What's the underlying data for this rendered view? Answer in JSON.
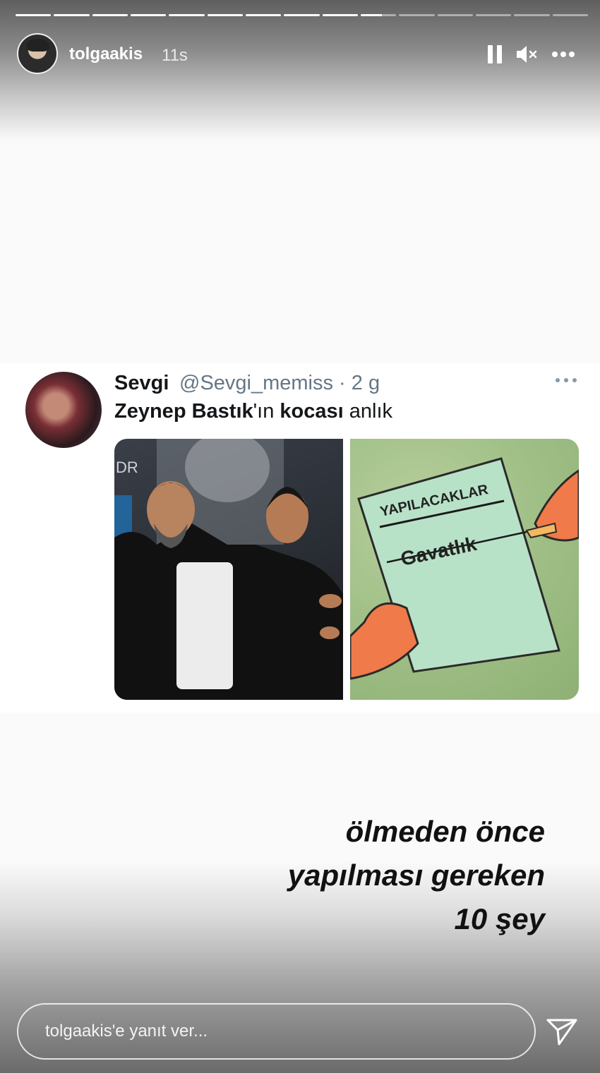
{
  "story": {
    "progress_segments": 15,
    "progress_completed_segments": 9,
    "progress_current_fraction": 0.6
  },
  "header": {
    "username": "tolgaakis",
    "time": "11s",
    "icons": [
      "pause-icon",
      "mute-icon",
      "more-icon"
    ]
  },
  "tweet": {
    "name": "Sevgi",
    "handle_time": "@Sevgi_memiss · 2 g",
    "text_part1": "Zeynep Bastık",
    "text_part2": "'ın ",
    "text_part3": "kocası",
    "text_part4": " anlık",
    "image2_note_title": "YAPILACAKLAR",
    "image2_note_item": "Gavatlık"
  },
  "caption": {
    "line1": "ölmeden önce",
    "line2": "yapılması gereken",
    "line3": "10 şey"
  },
  "reply": {
    "placeholder": "tolgaakis'e yanıt ver..."
  }
}
